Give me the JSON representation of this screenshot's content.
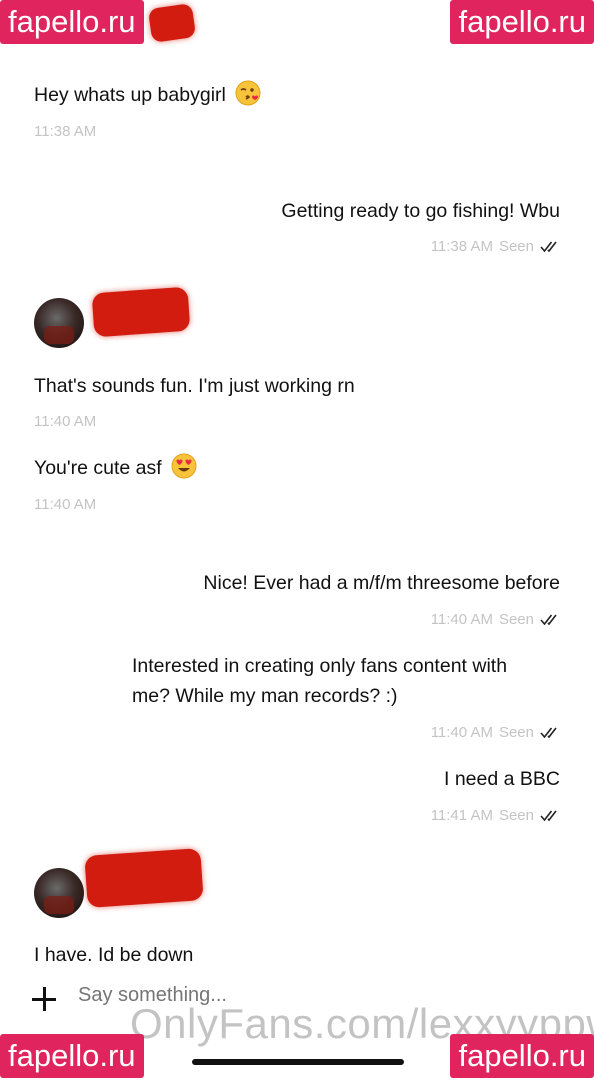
{
  "watermarks": {
    "site": "fapello.ru",
    "footer": "OnlyFans.com/lexxyyppw"
  },
  "messages": [
    {
      "id": "m1",
      "side": "left",
      "text": "Hey whats up babygirl",
      "emoji": "kissing-heart-emoji",
      "time": "11:38 AM"
    },
    {
      "id": "m2",
      "side": "right",
      "text": "Getting ready to go fishing! Wbu",
      "time": "11:38 AM",
      "status": "Seen"
    },
    {
      "id": "m3",
      "side": "left",
      "text": "That's sounds fun. I'm just working rn",
      "time": "11:40 AM"
    },
    {
      "id": "m4",
      "side": "left",
      "text": "You're cute asf",
      "emoji": "heart-eyes-emoji",
      "time": "11:40 AM"
    },
    {
      "id": "m5",
      "side": "right",
      "text": "Nice! Ever had a m/f/m threesome before",
      "time": "11:40 AM",
      "status": "Seen"
    },
    {
      "id": "m6",
      "side": "right",
      "lines": [
        "Interested in creating only fans content with",
        "me? While my man records? :)"
      ],
      "time": "11:40 AM",
      "status": "Seen"
    },
    {
      "id": "m7",
      "side": "right",
      "text": "I need a BBC",
      "time": "11:41 AM",
      "status": "Seen"
    },
    {
      "id": "m8",
      "side": "left",
      "text": "I have. Id be down"
    }
  ],
  "composer": {
    "placeholder": "Say something..."
  },
  "colors": {
    "watermark_bg": "#e0245e",
    "redaction": "#d11c0f",
    "meta_text": "#c4c4c4"
  }
}
